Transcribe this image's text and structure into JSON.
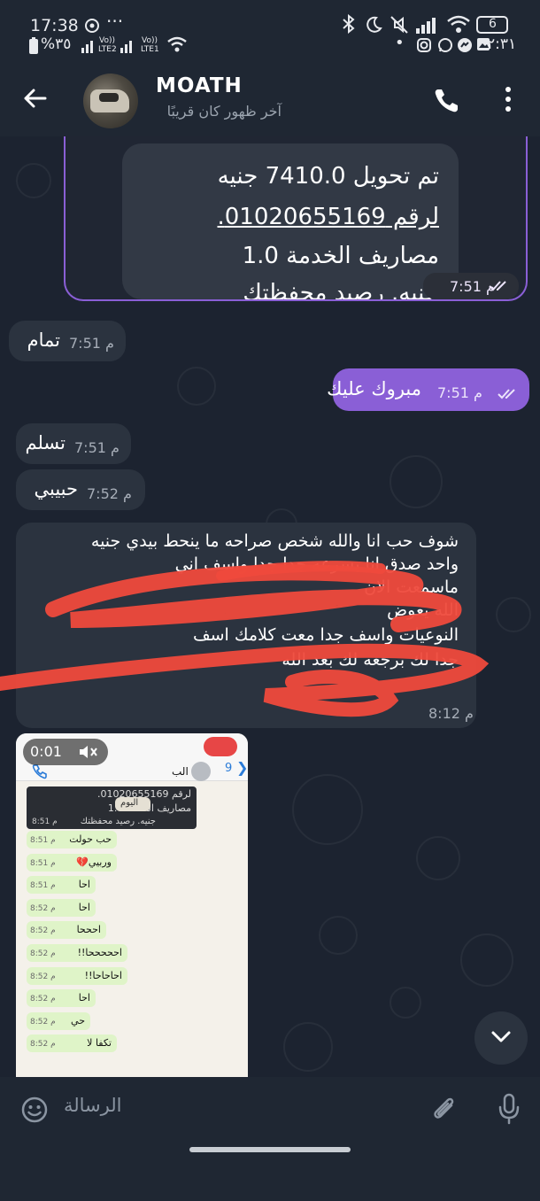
{
  "status_bar": {
    "time": "17:38",
    "battery_percent": "%٣٥",
    "lte2": "LTE2",
    "lte1": "LTE1",
    "vol": "Vo))",
    "right_time": "٢:٣١",
    "battery_box": "6"
  },
  "header": {
    "contact_name": "MOATH",
    "last_seen": "آخر ظهور كان قريبًا"
  },
  "messages": {
    "payment": {
      "line1": "تم تحويل 7410.0 جنيه",
      "line2": "لرقم 01020655169.",
      "line3": "مصاريف الخدمة 1.0",
      "line4": "جنيه. رصيد محفظتك",
      "time": "7:51 م"
    },
    "m1": {
      "text": "تمام",
      "time": "7:51 م"
    },
    "m2": {
      "text": "مبروك عليك",
      "time": "7:51 م"
    },
    "m3": {
      "text": "تسلم",
      "time": "7:51 م"
    },
    "m4": {
      "text": "حبيبي",
      "time": "7:52 م"
    },
    "long": {
      "line1": "شوف حب انا والله شخص صراحه ما ينحط بيدي جنيه",
      "line2": "واحد صدق انا بسرعه جدا جدا واسف اني",
      "line3": "ماسمعت الان",
      "line4": "الله يعوض",
      "line5": "النوعيات واسف جدا معت كلامك اسف",
      "line6": "جدا لك برجعه لك بعد الله",
      "time": "8:12 م"
    }
  },
  "screenshot_thumb": {
    "video_time": "0:01",
    "back_count": "9",
    "contact": "الب",
    "day_badge": "اليوم",
    "quoted_line1": "لرقم 01020655169.",
    "quoted_line2": "مصاريف الخدمة 1.0",
    "quoted_line3": "جنيه. رصيد محفظتك",
    "quoted_time": "8:51 م",
    "rows": [
      {
        "text": "حب حولت",
        "time": "8:51 م"
      },
      {
        "text": "وربيي💔",
        "time": "8:51 م"
      },
      {
        "text": "احا",
        "time": "8:51 م"
      },
      {
        "text": "احا",
        "time": "8:52 م"
      },
      {
        "text": "احححا",
        "time": "8:52 م"
      },
      {
        "text": "احححححا!!",
        "time": "8:52 م"
      },
      {
        "text": "احاحاحا!!",
        "time": "8:52 م"
      },
      {
        "text": "احا",
        "time": "8:52 م"
      },
      {
        "text": "حي",
        "time": "8:52 م"
      },
      {
        "text": "تكفا لا",
        "time": "8:52 م"
      }
    ]
  },
  "input": {
    "placeholder": "الرسالة"
  }
}
